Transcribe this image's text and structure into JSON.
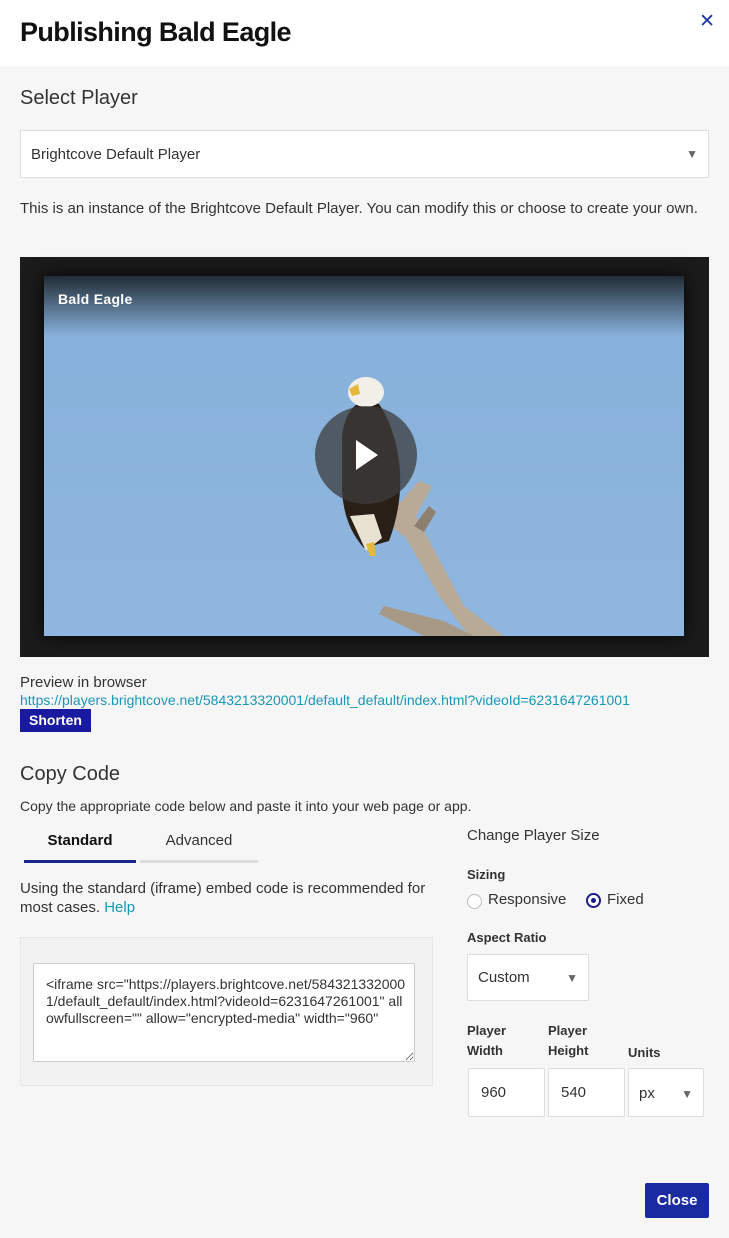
{
  "header": {
    "title": "Publishing Bald Eagle",
    "close_icon": "close-icon"
  },
  "player": {
    "section_title": "Select Player",
    "selected": "Brightcove Default Player",
    "description": "This is an instance of the Brightcove Default Player. You can modify this or choose to create your own."
  },
  "video": {
    "title": "Bald Eagle",
    "play_icon": "play-icon"
  },
  "preview": {
    "label": "Preview in browser",
    "url": "https://players.brightcove.net/5843213320001/default_default/index.html?videoId=6231647261001",
    "shorten_label": "Shorten"
  },
  "copy_code": {
    "section_title": "Copy Code",
    "instructions": "Copy the appropriate code below and paste it into your web page or app.",
    "tabs": [
      {
        "label": "Standard",
        "active": true
      },
      {
        "label": "Advanced",
        "active": false
      }
    ],
    "standard_note": "Using the standard (iframe) embed code is recommended for most cases.",
    "help_link": "Help",
    "embed_code": "<iframe src=\"https://players.brightcove.net/5843213320001/default_default/index.html?videoId=6231647261001\" allowfullscreen=\"\" allow=\"encrypted-media\" width=\"960\""
  },
  "player_size": {
    "title": "Change Player Size",
    "sizing_label": "Sizing",
    "sizing_options": [
      {
        "label": "Responsive",
        "checked": false
      },
      {
        "label": "Fixed",
        "checked": true
      }
    ],
    "aspect_ratio_label": "Aspect Ratio",
    "aspect_ratio_value": "Custom",
    "width_label": "Player Width",
    "height_label": "Player Height",
    "units_label": "Units",
    "width_value": "960",
    "height_value": "540",
    "units_value": "px"
  },
  "footer": {
    "close_label": "Close"
  },
  "colors": {
    "primary": "#1a2aa0",
    "link": "#1897b8",
    "background": "#f6f6f6"
  }
}
